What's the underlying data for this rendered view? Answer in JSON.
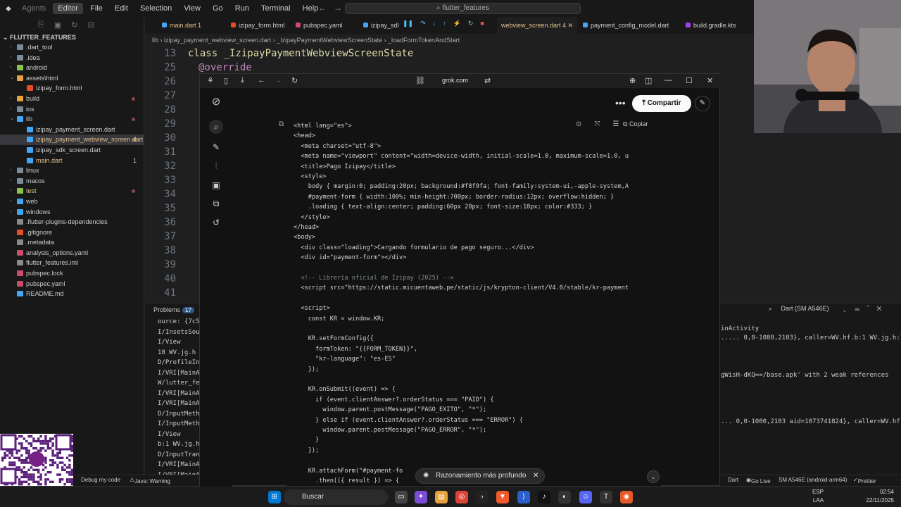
{
  "titlebar": {
    "menu": [
      "Agents",
      "Editor",
      "File",
      "Edit",
      "Selection",
      "View",
      "Go",
      "Run",
      "Terminal",
      "Help"
    ],
    "search": "flutter_features"
  },
  "explorer": {
    "title": "FLUTTER_FEATURES",
    "items": [
      {
        "label": ".dart_tool",
        "kind": "folder",
        "color": "#7a8b99"
      },
      {
        "label": ".idea",
        "kind": "folder",
        "color": "#7a8b99"
      },
      {
        "label": "android",
        "kind": "folder",
        "color": "#8bc34a"
      },
      {
        "label": "assets\\html",
        "kind": "folder-open",
        "color": "#e6a23c"
      },
      {
        "label": "izipay_form.html",
        "kind": "file",
        "color": "#e44d26"
      },
      {
        "label": "build",
        "kind": "folder",
        "color": "#e6a23c"
      },
      {
        "label": "ios",
        "kind": "folder",
        "color": "#7a8b99"
      },
      {
        "label": "lib",
        "kind": "folder-open",
        "color": "#42a5f5"
      },
      {
        "label": "izipay_payment_screen.dart",
        "kind": "file",
        "color": "#42a5f5"
      },
      {
        "label": "izipay_payment_webview_screen.dart",
        "kind": "file",
        "color": "#42a5f5",
        "badge": "4"
      },
      {
        "label": "izipay_sdk_screen.dart",
        "kind": "file",
        "color": "#42a5f5"
      },
      {
        "label": "main.dart",
        "kind": "file",
        "color": "#42a5f5",
        "badge": "1"
      },
      {
        "label": "linux",
        "kind": "folder",
        "color": "#7a8b99"
      },
      {
        "label": "macos",
        "kind": "folder",
        "color": "#7a8b99"
      },
      {
        "label": "test",
        "kind": "folder",
        "color": "#8bc34a"
      },
      {
        "label": "web",
        "kind": "folder",
        "color": "#42a5f5"
      },
      {
        "label": "windows",
        "kind": "folder",
        "color": "#42a5f5"
      },
      {
        "label": ".flutter-plugins-dependencies",
        "kind": "file",
        "color": "#8a8a8a"
      },
      {
        "label": ".gitignore",
        "kind": "file",
        "color": "#e44d26"
      },
      {
        "label": ".metadata",
        "kind": "file",
        "color": "#8a8a8a"
      },
      {
        "label": "analysis_options.yaml",
        "kind": "file",
        "color": "#cb4b6b"
      },
      {
        "label": "flutter_features.iml",
        "kind": "file",
        "color": "#8a8a8a"
      },
      {
        "label": "pubspec.lock",
        "kind": "file",
        "color": "#cb4b6b"
      },
      {
        "label": "pubspec.yaml",
        "kind": "file",
        "color": "#cb4b6b"
      },
      {
        "label": "README.md",
        "kind": "file",
        "color": "#42a5f5"
      }
    ]
  },
  "tabs": [
    {
      "label": "main.dart",
      "badge": "1"
    },
    {
      "label": "izipay_form.html"
    },
    {
      "label": "pubspec.yaml"
    },
    {
      "label": "izipay_sdl"
    },
    {
      "label": "webview_screen.dart",
      "badge": "4"
    },
    {
      "label": "payment_config_model.dart"
    },
    {
      "label": "build.gradle.kts"
    }
  ],
  "breadcrumb": [
    "lib",
    "izipay_payment_webview_screen.dart",
    "_IzipayPaymentWebviewScreenState",
    "_loadFormTokenAndStart"
  ],
  "editor": {
    "lines": [
      {
        "n": "13",
        "text": "class _IzipayPaymentWebviewScreenState"
      },
      {
        "n": "25",
        "text": "@override"
      },
      {
        "n": "26",
        "text": ""
      },
      {
        "n": "27",
        "text": ""
      },
      {
        "n": "28",
        "text": ""
      },
      {
        "n": "29",
        "text": ""
      },
      {
        "n": "30",
        "text": ""
      },
      {
        "n": "31",
        "text": ""
      },
      {
        "n": "32",
        "text": ""
      },
      {
        "n": "33",
        "text": ""
      },
      {
        "n": "34",
        "text": ""
      },
      {
        "n": "35",
        "text": ""
      },
      {
        "n": "36",
        "text": ""
      },
      {
        "n": "37",
        "text": ""
      },
      {
        "n": "38",
        "text": ""
      },
      {
        "n": "39",
        "text": ""
      },
      {
        "n": "40",
        "text": ""
      },
      {
        "n": "41",
        "text": ""
      }
    ]
  },
  "panel": {
    "problems_label": "Problems",
    "problems_count": "17",
    "device": "Dart (SM A546E)",
    "left_logs": [
      "ource: {7c5",
      "I/InsetsSou",
      "I/View",
      "18 WV.jg.h",
      "D/ProfileIn",
      "I/VRI[MainA",
      "W/lutter_fe",
      "I/VRI[MainA",
      "I/VRI[MainA",
      "D/InputMeth",
      "I/InputMeth",
      "I/View",
      "b:1 WV.jg.h",
      "D/InputTran",
      "I/VRI[MainA",
      "I/VRI[MainA"
    ],
    "right_logs": [
      "inActivity",
      "..... 0,0-1080,2103}, caller=WV.hf.b:1 WV.jg.h:1",
      "",
      "",
      "",
      "gWisH-dKQ==/base.apk' with 2 weak references",
      "",
      "",
      "",
      "",
      "... 0,0-1080,2103 aid=1073741824}, caller=WV.hf."
    ]
  },
  "statusbar": {
    "debug": "Debug my code",
    "java": "Java: Warning",
    "lang": "Dart",
    "golive": "Go Live",
    "device": "SM A546E (android-arm64)",
    "prettier": "Prettier"
  },
  "taskbar": {
    "search": "Buscar",
    "lang": "ESP",
    "region": "LAA",
    "time": "02:54",
    "date": "22/11/2025"
  },
  "browser": {
    "url": "grok.com",
    "share": "Compartir",
    "copy": "Copiar",
    "reasoning_chip": "Razonamiento más profundo",
    "code": [
      {
        "t": "<html lang=\"es\">",
        "c": "#d4d4d4"
      },
      {
        "t": "<head>",
        "c": "#d4d4d4"
      },
      {
        "t": "  <meta charset=\"utf-8\">",
        "c": "#d4d4d4"
      },
      {
        "t": "  <meta name=\"viewport\" content=\"width=device-width, initial-scale=1.0, maximum-scale=1.0, u",
        "c": "#d4d4d4"
      },
      {
        "t": "  <title>Pago Izipay</title>",
        "c": "#d4d4d4"
      },
      {
        "t": "  <style>",
        "c": "#d4d4d4"
      },
      {
        "t": "    body { margin:0; padding:20px; background:#f8f9fa; font-family:system-ui,-apple-system,A",
        "c": "#d4d4d4"
      },
      {
        "t": "    #payment-form { width:100%; min-height:700px; border-radius:12px; overflow:hidden; }",
        "c": "#d4d4d4"
      },
      {
        "t": "    .loading { text-align:center; padding:60px 20px; font-size:18px; color:#333; }",
        "c": "#d4d4d4"
      },
      {
        "t": "  </style>",
        "c": "#d4d4d4"
      },
      {
        "t": "</head>",
        "c": "#d4d4d4"
      },
      {
        "t": "<body>",
        "c": "#d4d4d4"
      },
      {
        "t": "  <div class=\"loading\">Cargando formulario de pago seguro...</div>",
        "c": "#d4d4d4"
      },
      {
        "t": "  <div id=\"payment-form\"></div>",
        "c": "#d4d4d4"
      },
      {
        "t": "",
        "c": "#d4d4d4"
      },
      {
        "t": "  <!-- Librería oficial de Izipay (2025) -->",
        "c": "#7f8c8d"
      },
      {
        "t": "  <script src=\"https://static.micuentaweb.pe/static/js/krypton-client/V4.0/stable/kr-payment",
        "c": "#d4d4d4"
      },
      {
        "t": "",
        "c": "#d4d4d4"
      },
      {
        "t": "  <script>",
        "c": "#d4d4d4"
      },
      {
        "t": "    const KR = window.KR;",
        "c": "#d4d4d4"
      },
      {
        "t": "",
        "c": "#d4d4d4"
      },
      {
        "t": "    KR.setFormConfig({",
        "c": "#d4d4d4"
      },
      {
        "t": "      formToken: \"{{FORM_TOKEN}}\",",
        "c": "#d4d4d4"
      },
      {
        "t": "      \"kr-language\": \"es-ES\"",
        "c": "#d4d4d4"
      },
      {
        "t": "    });",
        "c": "#d4d4d4"
      },
      {
        "t": "",
        "c": "#d4d4d4"
      },
      {
        "t": "    KR.onSubmit((event) => {",
        "c": "#d4d4d4"
      },
      {
        "t": "      if (event.clientAnswer?.orderStatus === \"PAID\") {",
        "c": "#d4d4d4"
      },
      {
        "t": "        window.parent.postMessage(\"PAGO_EXITO\", \"*\");",
        "c": "#d4d4d4"
      },
      {
        "t": "      } else if (event.clientAnswer?.orderStatus === \"ERROR\") {",
        "c": "#d4d4d4"
      },
      {
        "t": "        window.parent.postMessage(\"PAGO_ERROR\", \"*\");",
        "c": "#d4d4d4"
      },
      {
        "t": "      }",
        "c": "#d4d4d4"
      },
      {
        "t": "    });",
        "c": "#d4d4d4"
      },
      {
        "t": "",
        "c": "#d4d4d4"
      },
      {
        "t": "    KR.attachForm(\"#payment-fo",
        "c": "#d4d4d4"
      },
      {
        "t": "      .then(({ result }) => {",
        "c": "#d4d4d4"
      }
    ]
  },
  "qr": {
    "brand": "yape"
  }
}
